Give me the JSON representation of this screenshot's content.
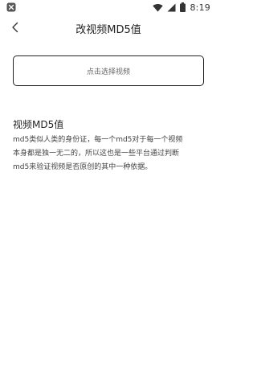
{
  "status_bar": {
    "time": "8:19",
    "icons": [
      "app-notification-icon",
      "wifi-icon",
      "signal-icon",
      "battery-icon"
    ]
  },
  "header": {
    "title": "改视频MD5值",
    "back_icon": "chevron-left-icon"
  },
  "main": {
    "select_button_label": "点击选择视频",
    "info_title": "视频MD5值",
    "info_lines": [
      "md5类似人类的身份证，每一个md5对于每一个视频",
      "本身都是独一无二的，所以这也是一些平台通过判断",
      "md5来验证视频是否原创的其中一种依据。"
    ]
  }
}
